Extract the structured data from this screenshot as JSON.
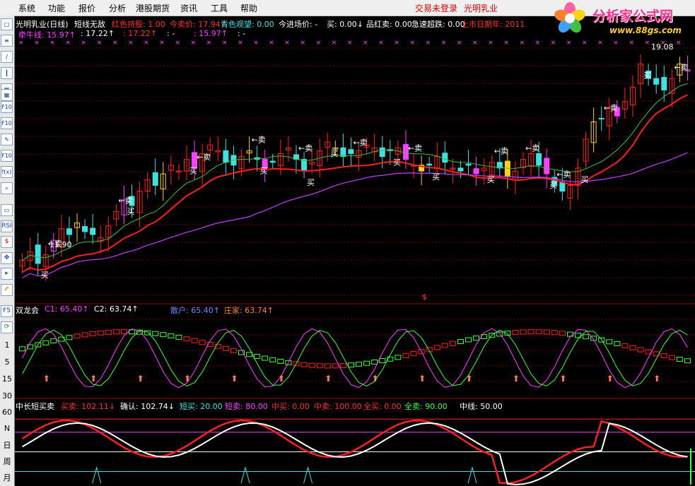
{
  "menu": {
    "items": [
      "系统",
      "功能",
      "报价",
      "分析",
      "港股期货",
      "资讯",
      "工具",
      "帮助"
    ],
    "login_status": "交易未登录",
    "stock_name": "光明乳业"
  },
  "logo": {
    "title": "分析家公式网",
    "url": "www.88gs.com"
  },
  "toolbar": {
    "icons": [
      "window-icon",
      "list-icon",
      "line-chart-icon",
      "candle-icon",
      "table-icon",
      "table-icon",
      "f10-icon",
      "f10-icon",
      "memo-icon",
      "f10-icon",
      "formula-icon",
      "zoom-icon",
      "analysis-icon",
      "rsi-icon",
      "dollar-icon",
      "move-icon",
      "flag-icon",
      "pen-icon"
    ],
    "icon_text": {
      "f10": "F10",
      "rsi": "RSI",
      "f5": "F5"
    },
    "periods": [
      "1",
      "5",
      "15",
      "30",
      "60",
      "N",
      "日",
      "周",
      "月"
    ]
  },
  "main_panel": {
    "title": "光明乳业(日线)",
    "indicator": "短线无敌",
    "items": [
      {
        "label": "红色持股: 1.00",
        "color": "#ff3030"
      },
      {
        "label": "今卖价: 17.94↑",
        "color": "#ff3030"
      },
      {
        "label": "青色观望: 0.00",
        "color": "#40e0e0"
      },
      {
        "label": "今进场价: -",
        "color": "#ffffff"
      },
      {
        "label": "买: 0.00↓",
        "color": "#ffffff"
      },
      {
        "label": "品红卖: 0.00",
        "color": "#ffffff"
      },
      {
        "label": "急速超跌: 0.00",
        "color": "#ffffff"
      },
      {
        "label": "上市日期年: 2011",
        "color": "#ff3030"
      }
    ],
    "line2": [
      {
        "label": "牵牛线: 15.97↑",
        "color": "#ff40ff"
      },
      {
        "label": ": 17.22↑",
        "color": "#ffffff"
      },
      {
        "label": ": 17.22↑",
        "color": "#ff3030"
      },
      {
        "label": ": -",
        "color": "#ffffff"
      },
      {
        "label": ": 15.97↑",
        "color": "#ff40ff"
      },
      {
        "label": ": -",
        "color": "#ffffff"
      }
    ],
    "high_label": "19.08",
    "low_label": "11.90",
    "sell_label": "卖",
    "buy_label": "买",
    "dollar_label": "$"
  },
  "sub1": {
    "title": "双龙会",
    "items": [
      {
        "label": "C1: 65.40↑",
        "color": "#ff40ff"
      },
      {
        "label": "C2: 63.74↑",
        "color": "#ffffff"
      },
      {
        "label": "散户: 65.40↑",
        "color": "#8080ff"
      },
      {
        "label": "庄家: 63.74↑",
        "color": "#ff8040"
      }
    ]
  },
  "sub2": {
    "title": "中长短买卖",
    "items": [
      {
        "label": "买卖: 102.11↓",
        "color": "#ff3030"
      },
      {
        "label": "确认: 102.74↓",
        "color": "#ffffff"
      },
      {
        "label": "短买: 20.00",
        "color": "#40e0e0"
      },
      {
        "label": "短卖: 80.00",
        "color": "#ff40ff"
      },
      {
        "label": "中买: 0.00",
        "color": "#ff3030"
      },
      {
        "label": "中卖: 100.00",
        "color": "#ff3030"
      },
      {
        "label": "全买: 0.00",
        "color": "#ff3030"
      },
      {
        "label": "全卖: 90.00",
        "color": "#40ff40"
      },
      {
        "label": "中线: 50.00",
        "color": "#ffffff"
      }
    ]
  },
  "chart_data": {
    "type": "candlestick",
    "series_close": [
      12.1,
      12.4,
      12.0,
      12.3,
      12.8,
      13.2,
      13.0,
      13.4,
      13.1,
      13.0,
      12.9,
      13.3,
      13.8,
      14.2,
      14.0,
      14.5,
      14.9,
      14.7,
      15.1,
      15.4,
      15.2,
      15.6,
      15.3,
      15.8,
      16.1,
      15.9,
      15.5,
      15.4,
      15.7,
      15.9,
      15.6,
      15.3,
      15.5,
      15.8,
      16.0,
      15.6,
      15.2,
      15.5,
      15.9,
      16.2,
      16.0,
      15.7,
      15.8,
      15.9,
      16.1,
      16.0,
      15.7,
      15.9,
      16.0,
      15.6,
      15.4,
      15.2,
      15.4,
      15.7,
      15.5,
      15.3,
      15.2,
      15.4,
      15.1,
      15.3,
      15.5,
      15.3,
      15.0,
      15.2,
      15.6,
      15.8,
      15.4,
      15.1,
      14.7,
      14.5,
      14.7,
      15.3,
      16.3,
      16.9,
      17.0,
      17.4,
      17.1,
      17.6,
      18.1,
      18.9,
      18.4,
      18.2,
      18.0,
      18.4,
      18.9,
      18.7
    ]
  }
}
